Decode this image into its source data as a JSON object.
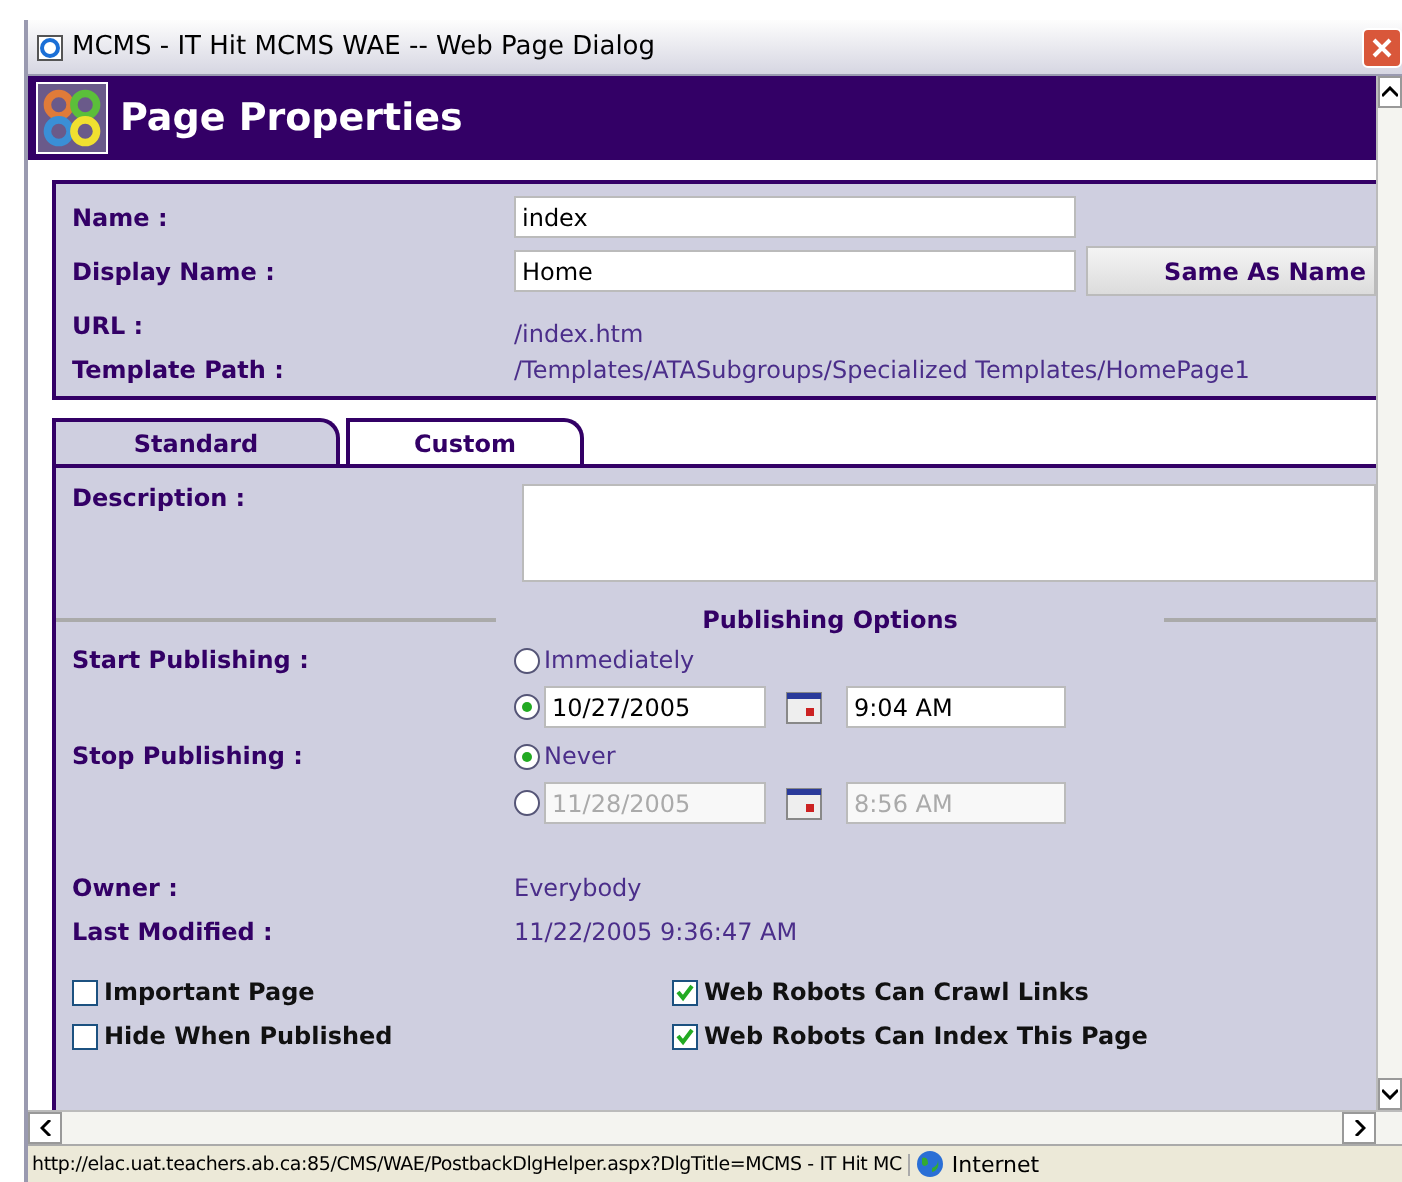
{
  "window": {
    "title": "MCMS - IT Hit MCMS WAE -- Web Page Dialog"
  },
  "header": {
    "title": "Page Properties"
  },
  "fields": [
    {
      "label": "Name :",
      "kind": "input",
      "value": "index"
    },
    {
      "label": "Display Name :",
      "kind": "input",
      "value": "Home"
    },
    {
      "label": "URL :",
      "kind": "text",
      "value": "/index.htm"
    },
    {
      "label": "Template Path :",
      "kind": "text",
      "value": "/Templates/ATASubgroups/Specialized Templates/HomePage1"
    }
  ],
  "same_as_name_button": "Same As Name",
  "tabs": [
    {
      "label": "Standard",
      "selected": true
    },
    {
      "label": "Custom",
      "selected": false
    }
  ],
  "description": {
    "label": "Description :"
  },
  "publishing_options": {
    "title": "Publishing Options",
    "schedules": [
      {
        "label": "Start Publishing :",
        "options": [
          {
            "kind": "text",
            "label": "Immediately",
            "selected": false
          },
          {
            "kind": "datetime",
            "date": "10/27/2005",
            "time": "9:04 AM",
            "selected": true,
            "disabled": false
          }
        ]
      },
      {
        "label": "Stop Publishing :",
        "options": [
          {
            "kind": "text",
            "label": "Never",
            "selected": true
          },
          {
            "kind": "datetime",
            "date": "11/28/2005",
            "time": "8:56 AM",
            "selected": false,
            "disabled": true
          }
        ]
      }
    ]
  },
  "info": [
    {
      "label": "Owner :",
      "value": "Everybody"
    },
    {
      "label": "Last Modified :",
      "value": "11/22/2005 9:36:47 AM"
    }
  ],
  "checkboxes": [
    {
      "label": "Important Page",
      "checked": false
    },
    {
      "label": "Web Robots Can Crawl Links",
      "checked": true
    },
    {
      "label": "Hide When Published",
      "checked": false
    },
    {
      "label": "Web Robots Can Index This Page",
      "checked": true
    }
  ],
  "status_bar": {
    "url": "http://elac.uat.teachers.ab.ca:85/CMS/WAE/PostbackDlgHelper.aspx?DlgTitle=MCMS - IT Hit MC",
    "zone": "Internet"
  }
}
